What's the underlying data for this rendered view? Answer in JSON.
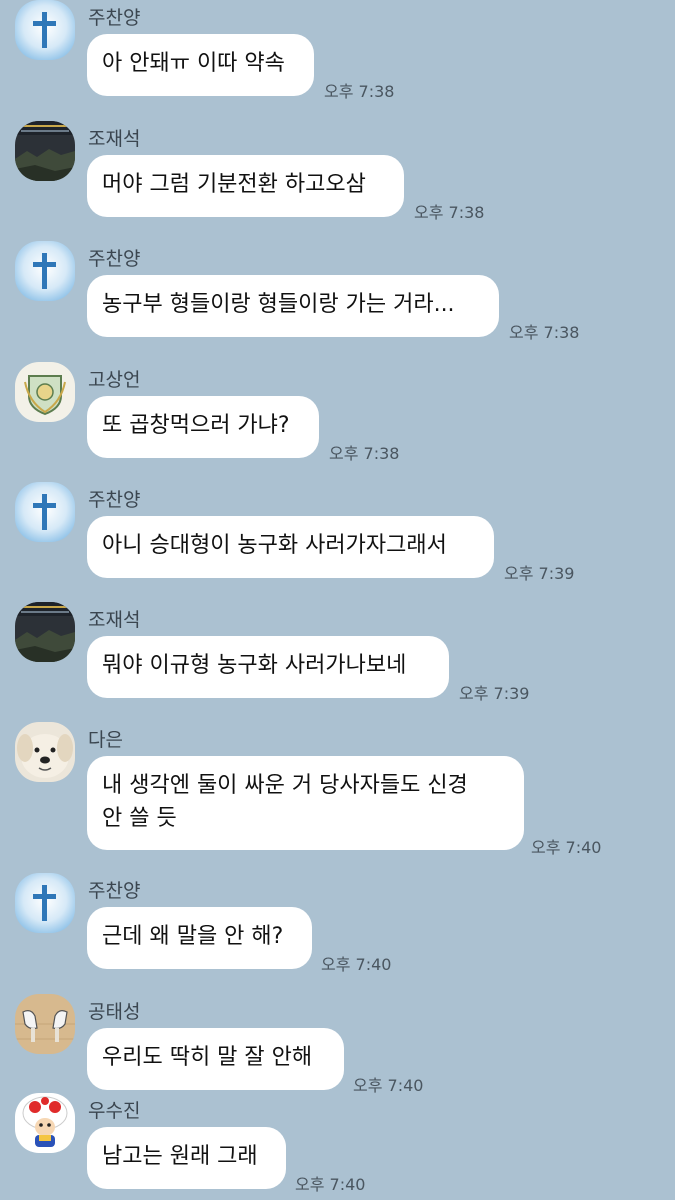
{
  "messages": [
    {
      "sender": "주찬양",
      "avatar": "cross-sky-icon",
      "text": [
        "아 안돼ㅠ 이따 약속"
      ],
      "time": "오후 7:38"
    },
    {
      "sender": "조재석",
      "avatar": "dark-landscape-icon",
      "text": [
        "머야 그럼 기분전환 하고오삼"
      ],
      "time": "오후 7:38"
    },
    {
      "sender": "주찬양",
      "avatar": "cross-sky-icon",
      "text": [
        "농구부 형들이랑 형들이랑 가는 거라..."
      ],
      "time": "오후 7:38"
    },
    {
      "sender": "고상언",
      "avatar": "emblem-badge-icon",
      "text": [
        "또 곱창먹으러 가냐?"
      ],
      "time": "오후 7:38"
    },
    {
      "sender": "주찬양",
      "avatar": "cross-sky-icon",
      "text": [
        "아니 승대형이 농구화 사러가자그래서"
      ],
      "time": "오후 7:39"
    },
    {
      "sender": "조재석",
      "avatar": "dark-landscape-icon",
      "text": [
        "뭐야 이규형 농구화 사러가나보네"
      ],
      "time": "오후 7:39"
    },
    {
      "sender": "다은",
      "avatar": "puppy-icon",
      "text": [
        "내 생각엔 둘이 싸운 거 당사자들도 신경",
        "안 쓸 듯"
      ],
      "time": "오후 7:40"
    },
    {
      "sender": "주찬양",
      "avatar": "cross-sky-icon",
      "text": [
        "근데 왜 말을 안 해?"
      ],
      "time": "오후 7:40"
    },
    {
      "sender": "공태성",
      "avatar": "sneakers-floor-icon",
      "text": [
        "우리도 딱히 말 잘 안해"
      ],
      "time": "오후 7:40"
    },
    {
      "sender": "우수진",
      "avatar": "mushroom-character-icon",
      "text": [
        "남고는 원래 그래"
      ],
      "time": "오후 7:40"
    }
  ],
  "colors": {
    "background": "#abc1d1",
    "bubble": "#ffffff",
    "sender_text": "#3b4650",
    "time_text": "#4a5660"
  }
}
